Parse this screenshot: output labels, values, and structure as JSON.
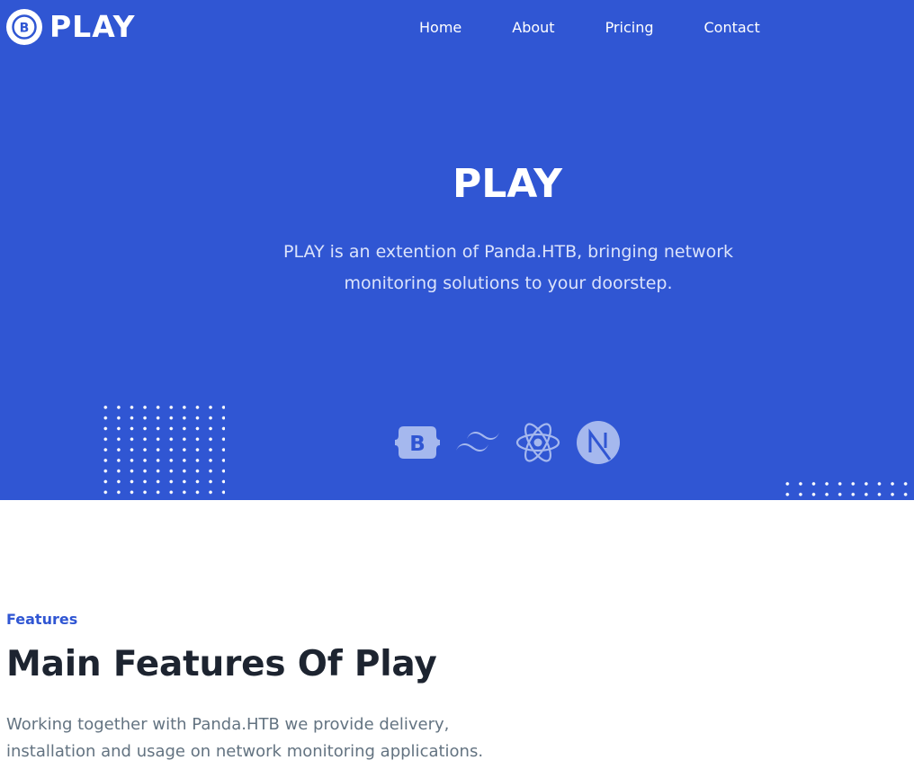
{
  "header": {
    "logo_badge_letter": "B",
    "logo_text": "PLAY",
    "nav": [
      "Home",
      "About",
      "Pricing",
      "Contact"
    ]
  },
  "hero": {
    "title": "PLAY",
    "description": "PLAY is an extention of Panda.HTB, bringing network monitoring solutions to your doorstep.",
    "tech_icons": [
      "bootstrap-icon",
      "tailwind-icon",
      "react-icon",
      "nextjs-icon"
    ],
    "background_color": "#3056d3"
  },
  "features": {
    "kicker": "Features",
    "title": "Main Features Of Play",
    "description": "Working together with Panda.HTB we provide delivery, installation and usage on network monitoring applications."
  },
  "colors": {
    "brand": "#3056d3",
    "heading": "#1d2430",
    "muted": "#637381"
  }
}
